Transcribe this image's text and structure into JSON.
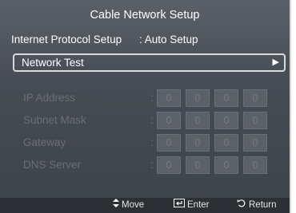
{
  "screen": {
    "title": "Cable Network Setup",
    "internet_protocol": {
      "label": "Internet Protocol Setup",
      "value": ": Auto Setup"
    },
    "network_test": {
      "label": "Network Test",
      "arrow": "▶"
    },
    "fields": [
      {
        "label": "IP Address",
        "colon": ":",
        "octets": [
          "0",
          "0",
          "0",
          "0"
        ]
      },
      {
        "label": "Subnet Mask",
        "colon": ":",
        "octets": [
          "0",
          "0",
          "0",
          "0"
        ]
      },
      {
        "label": "Gateway",
        "colon": ":",
        "octets": [
          "0",
          "0",
          "0",
          "0"
        ]
      },
      {
        "label": "DNS Server",
        "colon": ":",
        "octets": [
          "0",
          "0",
          "0",
          "0"
        ]
      }
    ],
    "footer": {
      "move_icon": "move-icon",
      "move_label": "Move",
      "enter_icon": "enter-icon",
      "enter_label": "Enter",
      "return_icon": "return-icon",
      "return_label": "Return"
    }
  },
  "colors": {
    "background": "#474c54",
    "text": "#ffffff",
    "disabled_text": "#6a6e76",
    "highlight_border": "#d9dadc"
  }
}
